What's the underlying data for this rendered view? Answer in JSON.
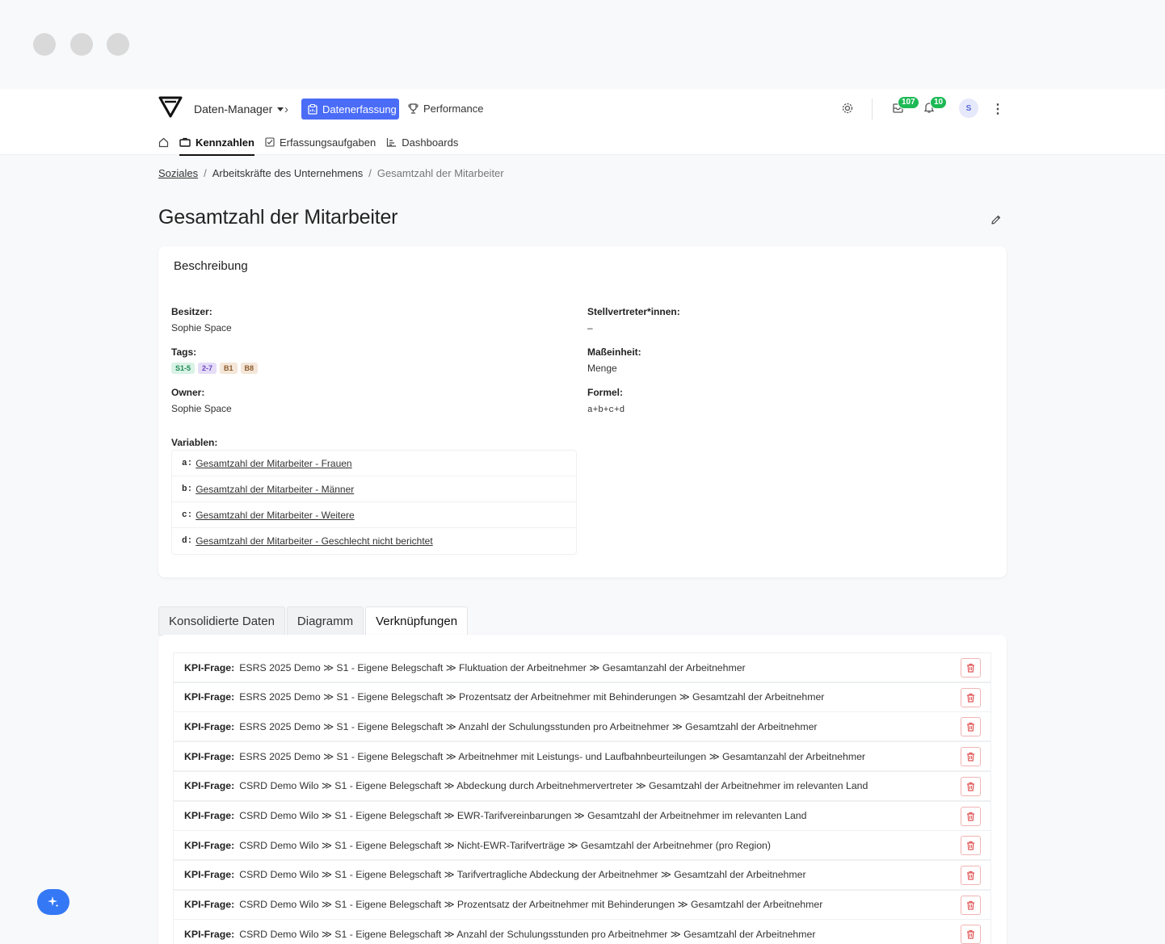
{
  "header": {
    "nav_dropdown": "Daten-Manager",
    "active_tab": "Datenerfassung",
    "performance": "Performance",
    "inbox_count": "107",
    "notif_count": "10",
    "avatar_initial": "S",
    "accent_color": "#4a6cf7",
    "badge_color": "#1db954"
  },
  "subnav": {
    "items": [
      "Kennzahlen",
      "Erfassungsaufgaben",
      "Dashboards"
    ]
  },
  "breadcrumb": {
    "root": "Soziales",
    "middle": "Arbeitskräfte des Unternehmens",
    "current": "Gesamtzahl der Mitarbeiter",
    "separator": "/"
  },
  "page_title": "Gesamtzahl der Mitarbeiter",
  "description": {
    "heading": "Beschreibung",
    "owner_label": "Besitzer:",
    "owner_value": "Sophie Space",
    "tags_label": "Tags:",
    "tags": [
      {
        "text": "S1-5",
        "bg": "#d9f2e6",
        "fg": "#1f8a55"
      },
      {
        "text": "2-7",
        "bg": "#e5dcf7",
        "fg": "#6b45c2"
      },
      {
        "text": "B1",
        "bg": "#f4e6d8",
        "fg": "#8a5a2b"
      },
      {
        "text": "B8",
        "bg": "#f4e6d8",
        "fg": "#8a5a2b"
      }
    ],
    "owner2_label": "Owner:",
    "owner2_value": "Sophie Space",
    "deputy_label": "Stellvertreter*innen:",
    "deputy_value": "–",
    "unit_label": "Maßeinheit:",
    "unit_value": "Menge",
    "formula_label": "Formel:",
    "formula_value": "a+b+c+d",
    "variables_label": "Variablen:",
    "variables": [
      {
        "key": "a:",
        "name": "Gesamtzahl der Mitarbeiter - Frauen"
      },
      {
        "key": "b:",
        "name": "Gesamtzahl der Mitarbeiter - Männer"
      },
      {
        "key": "c:",
        "name": "Gesamtzahl der Mitarbeiter - Weitere"
      },
      {
        "key": "d:",
        "name": "Gesamtzahl der Mitarbeiter - Geschlecht nicht berichtet"
      }
    ]
  },
  "tabs": [
    "Konsolidierte Daten",
    "Diagramm",
    "Verknüpfungen"
  ],
  "links": {
    "prefix": "KPI-Frage:",
    "rows": [
      "ESRS 2025 Demo ≫ S1 - Eigene Belegschaft ≫ Fluktuation der Arbeitnehmer ≫ Gesamtanzahl der Arbeitnehmer",
      "ESRS 2025 Demo ≫ S1 - Eigene Belegschaft ≫ Prozentsatz der Arbeitnehmer mit Behinderungen ≫ Gesamtzahl der Arbeitnehmer",
      "ESRS 2025 Demo ≫ S1 - Eigene Belegschaft ≫ Anzahl der Schulungsstunden pro Arbeitnehmer ≫ Gesamtzahl der Arbeitnehmer",
      "ESRS 2025 Demo ≫ S1 - Eigene Belegschaft ≫ Arbeitnehmer mit Leistungs- und Laufbahnbeurteilungen ≫ Gesamtanzahl der Arbeitnehmer",
      "CSRD Demo Wilo ≫ S1 - Eigene Belegschaft ≫ Abdeckung durch Arbeitnehmervertreter ≫ Gesamtzahl der Arbeitnehmer im relevanten Land",
      "CSRD Demo Wilo ≫ S1 - Eigene Belegschaft ≫ EWR-Tarifvereinbarungen ≫ Gesamtzahl der Arbeitnehmer im relevanten Land",
      "CSRD Demo Wilo ≫ S1 - Eigene Belegschaft ≫ Nicht-EWR-Tarifverträge ≫ Gesamtzahl der Arbeitnehmer (pro Region)",
      "CSRD Demo Wilo ≫ S1 - Eigene Belegschaft ≫ Tarifvertragliche Abdeckung der Arbeitnehmer ≫ Gesamtzahl der Arbeitnehmer",
      "CSRD Demo Wilo ≫ S1 - Eigene Belegschaft ≫ Prozentsatz der Arbeitnehmer mit Behinderungen ≫ Gesamtzahl der Arbeitnehmer",
      "CSRD Demo Wilo ≫ S1 - Eigene Belegschaft ≫ Anzahl der Schulungsstunden pro Arbeitnehmer ≫ Gesamtzahl der Arbeitnehmer"
    ]
  }
}
